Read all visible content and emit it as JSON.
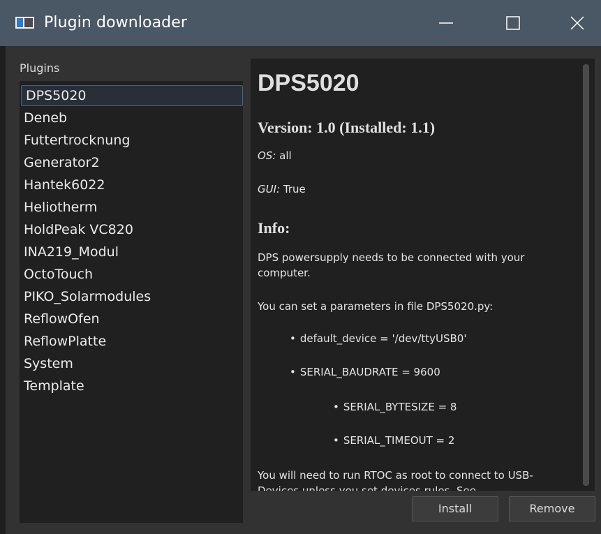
{
  "window": {
    "title": "Plugin downloader"
  },
  "plugins": {
    "label": "Plugins",
    "items": [
      "DPS5020",
      "Deneb",
      "Futtertrocknung",
      "Generator2",
      "Hantek6022",
      "Heliotherm",
      "HoldPeak VC820",
      "INA219_Modul",
      "OctoTouch",
      "PIKO_Solarmodules",
      "ReflowOfen",
      "ReflowPlatte",
      "System",
      "Template"
    ],
    "selected_index": 0
  },
  "detail": {
    "title": "DPS5020",
    "version": "Version: 1.0 (Installed: 1.1)",
    "os_label": "OS:",
    "os_value": " all",
    "gui_label": "GUI:",
    "gui_value": " True",
    "info_heading": "Info:",
    "para1": "DPS powersupply needs to be connected with your computer.",
    "para2": "You can set a parameters in file DPS5020.py:",
    "bullets": [
      "default_device = '/dev/ttyUSB0'",
      "SERIAL_BAUDRATE = 9600",
      "SERIAL_BYTESIZE = 8",
      "SERIAL_TIMEOUT = 2"
    ],
    "para3": "You will need to run RTOC as root to connect to USB-Devices unless you set devices rules. See"
  },
  "buttons": {
    "install": "Install",
    "remove": "Remove"
  }
}
